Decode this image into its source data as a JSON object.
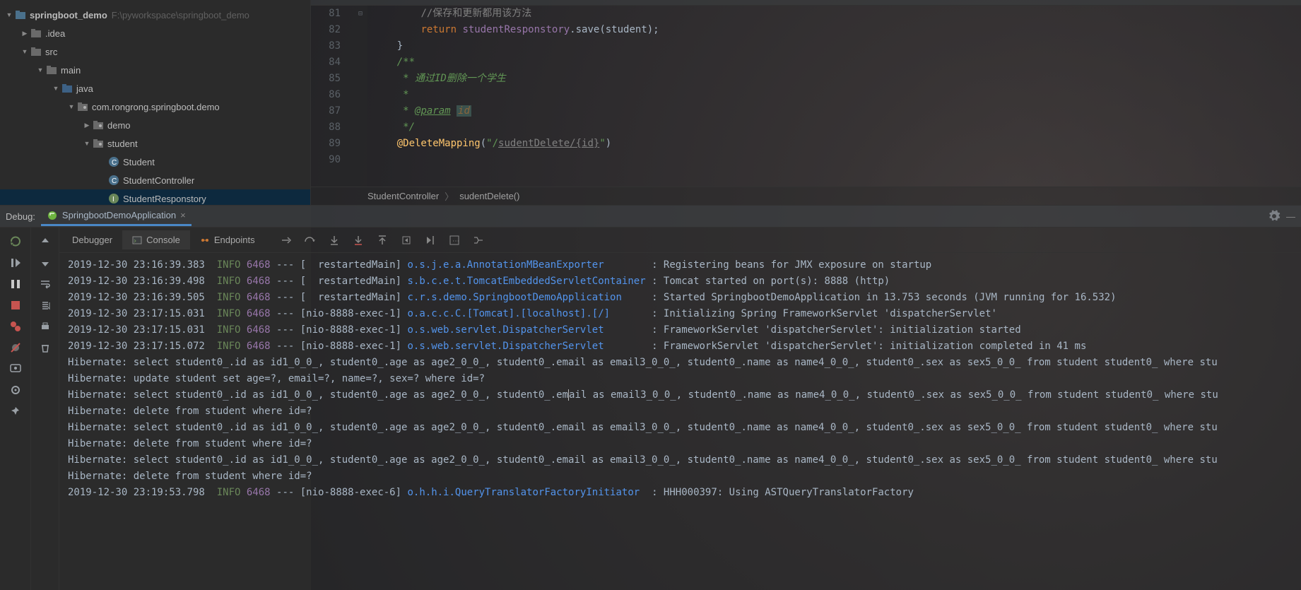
{
  "project": {
    "root_name": "springboot_demo",
    "root_path": "F:\\pyworkspace\\springboot_demo",
    "tree": [
      {
        "indent": 0,
        "arrow": "▼",
        "icon": "module",
        "label": "springboot_demo",
        "path": "F:\\pyworkspace\\springboot_demo",
        "root": true
      },
      {
        "indent": 1,
        "arrow": "▶",
        "icon": "folder-dark",
        "label": ".idea"
      },
      {
        "indent": 1,
        "arrow": "▼",
        "icon": "folder-dark",
        "label": "src"
      },
      {
        "indent": 2,
        "arrow": "▼",
        "icon": "folder-dark",
        "label": "main"
      },
      {
        "indent": 3,
        "arrow": "▼",
        "icon": "folder-blue",
        "label": "java"
      },
      {
        "indent": 4,
        "arrow": "▼",
        "icon": "package",
        "label": "com.rongrong.springboot.demo"
      },
      {
        "indent": 5,
        "arrow": "▶",
        "icon": "package",
        "label": "demo"
      },
      {
        "indent": 5,
        "arrow": "▼",
        "icon": "package",
        "label": "student"
      },
      {
        "indent": 6,
        "arrow": "",
        "icon": "class",
        "label": "Student"
      },
      {
        "indent": 6,
        "arrow": "",
        "icon": "class",
        "label": "StudentController"
      },
      {
        "indent": 6,
        "arrow": "",
        "icon": "interface",
        "label": "StudentResponstory",
        "selected": true
      }
    ]
  },
  "editor": {
    "lines": [
      {
        "num": 81,
        "html": "        <span class='c-comment'>//保存和更新都用该方法</span>"
      },
      {
        "num": 82,
        "html": "        <span class='c-keyword'>return</span> <span class='c-ident'>studentResponstory</span><span class='c-punct'>.save(student);</span>"
      },
      {
        "num": 83,
        "html": "    <span class='c-punct'>}</span>"
      },
      {
        "num": 84,
        "html": ""
      },
      {
        "num": 85,
        "html": "    <span class='c-comment-it'>/**</span>"
      },
      {
        "num": 86,
        "html": "    <span class='c-comment-it'> * 通过ID删除一个学生</span>"
      },
      {
        "num": 87,
        "html": "    <span class='c-comment-it'> *</span>"
      },
      {
        "num": 88,
        "html": "    <span class='c-comment-it'> * <span class='c-tag'>@param</span> <span class='c-param'>id</span></span>"
      },
      {
        "num": 89,
        "html": "    <span class='c-comment-it'> */</span>"
      },
      {
        "num": 90,
        "html": "    <span class='c-method'>@DeleteMapping</span><span class='c-punct'>(</span><span class='c-string'>\"/</span><span class='c-warn'>sudentDelete/{id}</span><span class='c-string'>\"</span><span class='c-punct'>)</span>"
      }
    ],
    "gutter_fold": [
      "",
      "",
      "",
      "",
      "⊟",
      "",
      "",
      "",
      "",
      "",
      ""
    ],
    "breadcrumb": [
      "StudentController",
      "sudentDelete()"
    ]
  },
  "debug": {
    "header_label": "Debug:",
    "run_config": "SpringbootDemoApplication",
    "tabs": {
      "debugger": "Debugger",
      "console": "Console",
      "endpoints": "Endpoints"
    }
  },
  "console": {
    "lines": [
      {
        "ts": "2019-12-30 23:16:39.383",
        "level": "INFO",
        "pid": "6468",
        "thread": "[  restartedMain]",
        "logger": "o.s.j.e.a.AnnotationMBeanExporter",
        "msg": ": Registering beans for JMX exposure on startup"
      },
      {
        "ts": "2019-12-30 23:16:39.498",
        "level": "INFO",
        "pid": "6468",
        "thread": "[  restartedMain]",
        "logger": "s.b.c.e.t.TomcatEmbeddedServletContainer",
        "msg": ": Tomcat started on port(s): 8888 (http)"
      },
      {
        "ts": "2019-12-30 23:16:39.505",
        "level": "INFO",
        "pid": "6468",
        "thread": "[  restartedMain]",
        "logger": "c.r.s.demo.SpringbootDemoApplication",
        "msg": ": Started SpringbootDemoApplication in 13.753 seconds (JVM running for 16.532)"
      },
      {
        "ts": "2019-12-30 23:17:15.031",
        "level": "INFO",
        "pid": "6468",
        "thread": "[nio-8888-exec-1]",
        "logger": "o.a.c.c.C.[Tomcat].[localhost].[/]",
        "msg": ": Initializing Spring FrameworkServlet 'dispatcherServlet'"
      },
      {
        "ts": "2019-12-30 23:17:15.031",
        "level": "INFO",
        "pid": "6468",
        "thread": "[nio-8888-exec-1]",
        "logger": "o.s.web.servlet.DispatcherServlet",
        "msg": ": FrameworkServlet 'dispatcherServlet': initialization started"
      },
      {
        "ts": "2019-12-30 23:17:15.072",
        "level": "INFO",
        "pid": "6468",
        "thread": "[nio-8888-exec-1]",
        "logger": "o.s.web.servlet.DispatcherServlet",
        "msg": ": FrameworkServlet 'dispatcherServlet': initialization completed in 41 ms"
      },
      {
        "raw": "Hibernate: select student0_.id as id1_0_0_, student0_.age as age2_0_0_, student0_.email as email3_0_0_, student0_.name as name4_0_0_, student0_.sex as sex5_0_0_ from student student0_ where stu"
      },
      {
        "raw": "Hibernate: update student set age=?, email=?, name=?, sex=? where id=?"
      },
      {
        "raw_cursor": "Hibernate: select student0_.id as id1_0_0_, student0_.age as age2_0_0_, student0_.em|ail as email3_0_0_, student0_.name as name4_0_0_, student0_.sex as sex5_0_0_ from student student0_ where stu"
      },
      {
        "raw": "Hibernate: delete from student where id=?"
      },
      {
        "raw": "Hibernate: select student0_.id as id1_0_0_, student0_.age as age2_0_0_, student0_.email as email3_0_0_, student0_.name as name4_0_0_, student0_.sex as sex5_0_0_ from student student0_ where stu"
      },
      {
        "raw": "Hibernate: delete from student where id=?"
      },
      {
        "raw": "Hibernate: select student0_.id as id1_0_0_, student0_.age as age2_0_0_, student0_.email as email3_0_0_, student0_.name as name4_0_0_, student0_.sex as sex5_0_0_ from student student0_ where stu"
      },
      {
        "raw": "Hibernate: delete from student where id=?"
      },
      {
        "ts": "2019-12-30 23:19:53.798",
        "level": "INFO",
        "pid": "6468",
        "thread": "[nio-8888-exec-6]",
        "logger": "o.h.h.i.QueryTranslatorFactoryInitiator",
        "msg": ": HHH000397: Using ASTQueryTranslatorFactory"
      }
    ]
  },
  "icons": {
    "close": "×"
  }
}
